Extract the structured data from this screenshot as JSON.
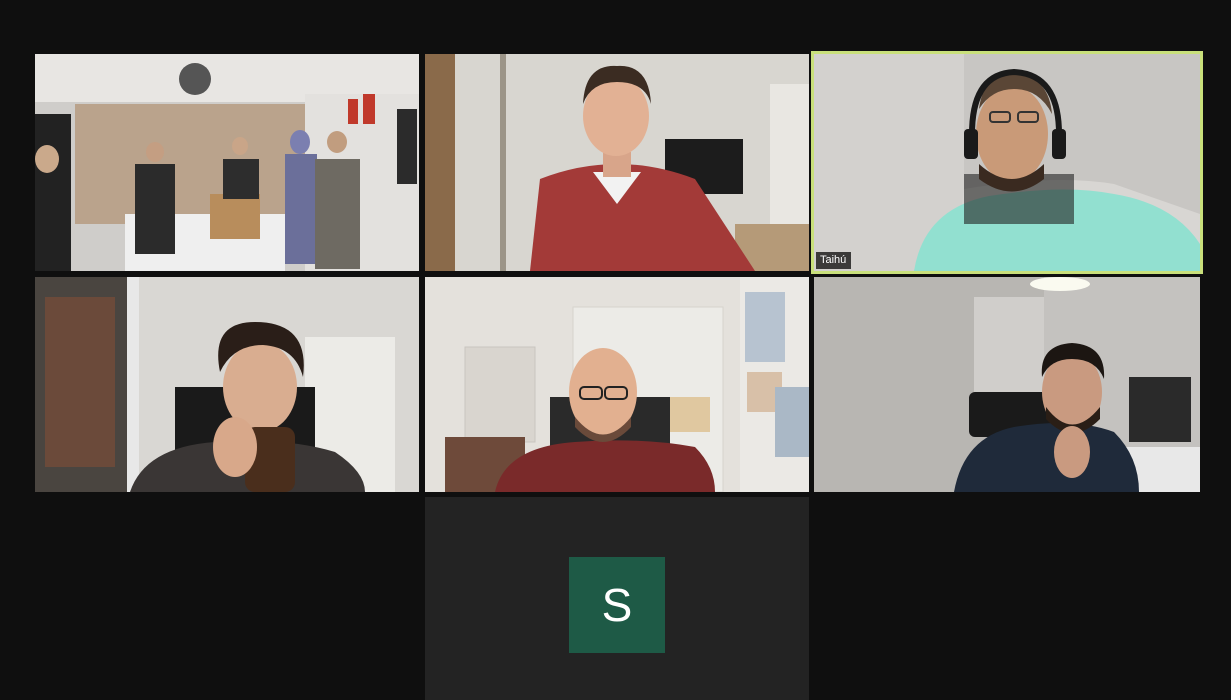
{
  "meeting": {
    "layout": "gallery-view",
    "active_speaker_color": "#c9e07b"
  },
  "participants": [
    {
      "tile": "office-group"
    },
    {
      "tile": "red-shirt"
    },
    {
      "tile": "headphones",
      "name": "Taihú",
      "active_speaker": true
    },
    {
      "tile": "drinking"
    },
    {
      "tile": "bald-glasses"
    },
    {
      "tile": "hand-on-chin"
    },
    {
      "tile": "no-video",
      "avatar_letter": "S",
      "avatar_color": "#1e5a46"
    }
  ]
}
